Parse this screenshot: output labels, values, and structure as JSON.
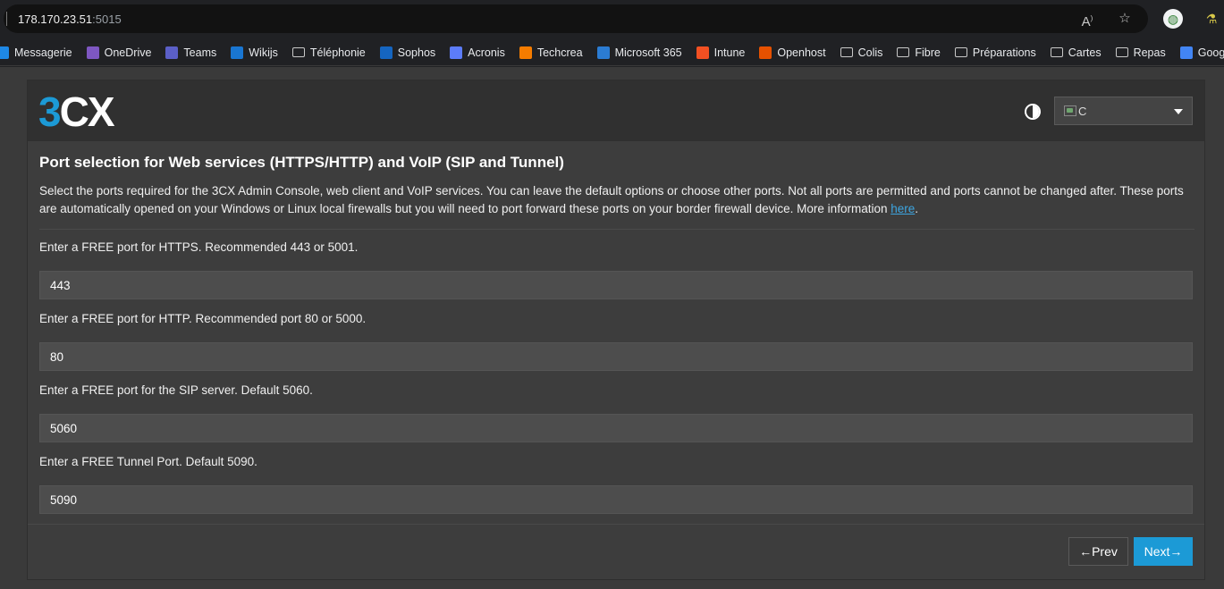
{
  "browser": {
    "url_host": "178.170.23.51",
    "url_port": ":5015",
    "bookmarks": [
      {
        "label": "Messagerie",
        "icon": "mail-icon",
        "color": "#1e88e5"
      },
      {
        "label": "OneDrive",
        "icon": "onedrive-icon",
        "color": "#7e57c2"
      },
      {
        "label": "Teams",
        "icon": "teams-icon",
        "color": "#5b5fc7"
      },
      {
        "label": "Wikijs",
        "icon": "wikijs-icon",
        "color": "#1976d2"
      },
      {
        "label": "Téléphonie",
        "icon": "folder-icon",
        "color": "#c8c8c8"
      },
      {
        "label": "Sophos",
        "icon": "sophos-icon",
        "color": "#1565c0"
      },
      {
        "label": "Acronis",
        "icon": "key-icon",
        "color": "#5c7cfa"
      },
      {
        "label": "Techcrea",
        "icon": "techcrea-icon",
        "color": "#f57c00"
      },
      {
        "label": "Microsoft 365",
        "icon": "m365-icon",
        "color": "#2b7cd3"
      },
      {
        "label": "Intune",
        "icon": "windows-icon",
        "color": "#f25022"
      },
      {
        "label": "Openhost",
        "icon": "openhost-icon",
        "color": "#e65100"
      },
      {
        "label": "Colis",
        "icon": "folder-icon",
        "color": "#c8c8c8"
      },
      {
        "label": "Fibre",
        "icon": "folder-icon",
        "color": "#c8c8c8"
      },
      {
        "label": "Préparations",
        "icon": "folder-icon",
        "color": "#c8c8c8"
      },
      {
        "label": "Cartes",
        "icon": "folder-icon",
        "color": "#c8c8c8"
      },
      {
        "label": "Repas",
        "icon": "folder-icon",
        "color": "#c8c8c8"
      },
      {
        "label": "Google",
        "icon": "google-chat-icon",
        "color": "#4285f4"
      }
    ]
  },
  "header": {
    "logo_3": "3",
    "logo_c": "C",
    "logo_x": "X",
    "language_value": "C"
  },
  "main": {
    "title": "Port selection for Web services (HTTPS/HTTP) and VoIP (SIP and Tunnel)",
    "description": "Select the ports required for the 3CX Admin Console, web client and VoIP services. You can leave the default options or choose other ports. Not all ports are permitted and ports cannot be changed after. These ports are automatically opened on your Windows or Linux local firewalls but you will need to port forward these ports on your border firewall device. More information ",
    "link_text": "here",
    "link_suffix": ".",
    "fields": [
      {
        "label": "Enter a FREE port for HTTPS. Recommended 443 or 5001.",
        "value": "443"
      },
      {
        "label": "Enter a FREE port for HTTP. Recommended port 80 or 5000.",
        "value": "80"
      },
      {
        "label": "Enter a FREE port for the SIP server. Default 5060.",
        "value": "5060"
      },
      {
        "label": "Enter a FREE Tunnel Port. Default 5090.",
        "value": "5090"
      }
    ]
  },
  "footer": {
    "prev_label": "←Prev",
    "next_label": "Next→"
  },
  "colors": {
    "accent": "#1c9ad6",
    "link": "#3da5e0"
  }
}
